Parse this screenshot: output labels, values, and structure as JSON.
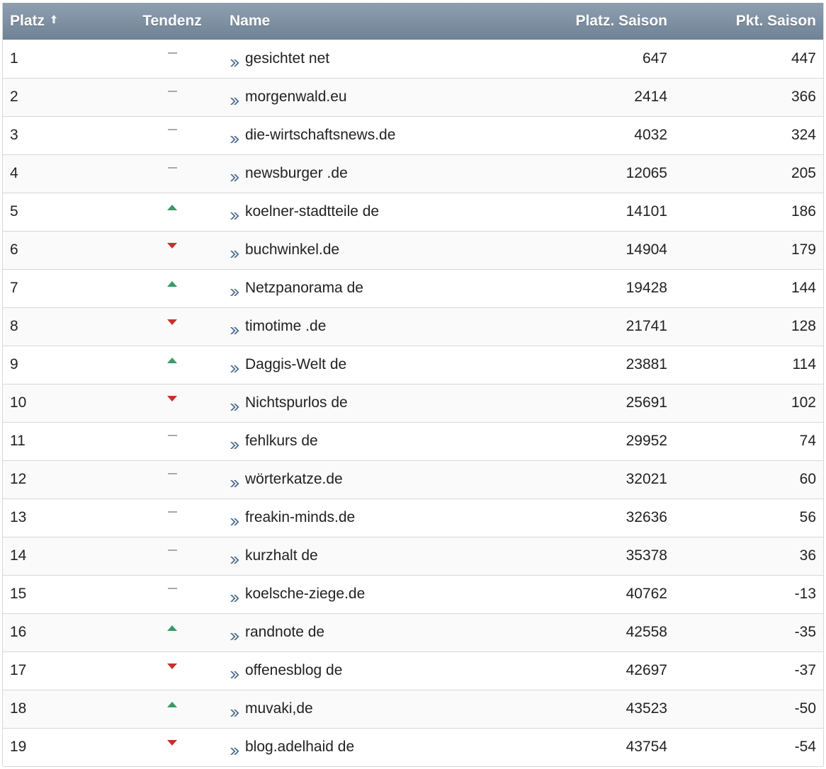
{
  "table": {
    "headers": {
      "platz": "Platz",
      "tendenz": "Tendenz",
      "name": "Name",
      "platz_saison": "Platz. Saison",
      "pkt_saison": "Pkt. Saison"
    },
    "sort_icon": "sort-ascending-icon",
    "colors": {
      "header_top": "#8e9fb0",
      "header_bottom": "#6f8396",
      "trend_up": "#3a9a6a",
      "trend_down": "#c8302a",
      "trend_flat": "#a9a9a9",
      "link_icon": "#4a6a8a"
    },
    "rows": [
      {
        "platz": "1",
        "trend": "flat",
        "name": "gesichtet net",
        "platz_saison": "647",
        "pkt_saison": "447"
      },
      {
        "platz": "2",
        "trend": "flat",
        "name": "morgenwald.eu",
        "platz_saison": "2414",
        "pkt_saison": "366"
      },
      {
        "platz": "3",
        "trend": "flat",
        "name": "die-wirtschaftsnews.de",
        "platz_saison": "4032",
        "pkt_saison": "324"
      },
      {
        "platz": "4",
        "trend": "flat",
        "name": "newsburger .de",
        "platz_saison": "12065",
        "pkt_saison": "205"
      },
      {
        "platz": "5",
        "trend": "up",
        "name": "koelner-stadtteile de",
        "platz_saison": "14101",
        "pkt_saison": "186"
      },
      {
        "platz": "6",
        "trend": "down",
        "name": "buchwinkel.de",
        "platz_saison": "14904",
        "pkt_saison": "179"
      },
      {
        "platz": "7",
        "trend": "up",
        "name": "Netzpanorama de",
        "platz_saison": "19428",
        "pkt_saison": "144"
      },
      {
        "platz": "8",
        "trend": "down",
        "name": "timotime .de",
        "platz_saison": "21741",
        "pkt_saison": "128"
      },
      {
        "platz": "9",
        "trend": "up",
        "name": "Daggis-Welt de",
        "platz_saison": "23881",
        "pkt_saison": "114"
      },
      {
        "platz": "10",
        "trend": "down",
        "name": "Nichtspurlos de",
        "platz_saison": "25691",
        "pkt_saison": "102"
      },
      {
        "platz": "11",
        "trend": "flat",
        "name": "fehlkurs de",
        "platz_saison": "29952",
        "pkt_saison": "74"
      },
      {
        "platz": "12",
        "trend": "flat",
        "name": "wörterkatze.de",
        "platz_saison": "32021",
        "pkt_saison": "60"
      },
      {
        "platz": "13",
        "trend": "flat",
        "name": "freakin-minds.de",
        "platz_saison": "32636",
        "pkt_saison": "56"
      },
      {
        "platz": "14",
        "trend": "flat",
        "name": "kurzhalt de",
        "platz_saison": "35378",
        "pkt_saison": "36"
      },
      {
        "platz": "15",
        "trend": "flat",
        "name": "koelsche-ziege.de",
        "platz_saison": "40762",
        "pkt_saison": "-13"
      },
      {
        "platz": "16",
        "trend": "up",
        "name": "randnote de",
        "platz_saison": "42558",
        "pkt_saison": "-35"
      },
      {
        "platz": "17",
        "trend": "down",
        "name": "offenesblog de",
        "platz_saison": "42697",
        "pkt_saison": "-37"
      },
      {
        "platz": "18",
        "trend": "up",
        "name": "muvaki,de",
        "platz_saison": "43523",
        "pkt_saison": "-50"
      },
      {
        "platz": "19",
        "trend": "down",
        "name": "blog.adelhaid de",
        "platz_saison": "43754",
        "pkt_saison": "-54"
      }
    ]
  }
}
